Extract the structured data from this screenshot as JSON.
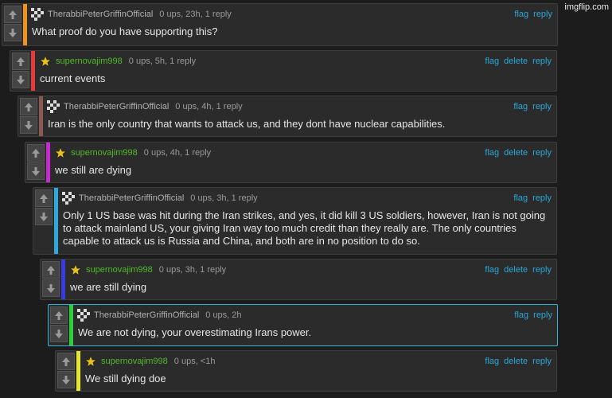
{
  "watermark": "imgflip.com",
  "colors": {
    "link": "#2aa7d8",
    "green_user": "#4fb92a",
    "grey_user": "#b0b0b0"
  },
  "comments": [
    {
      "user": "TherabbiPeterGriffinOfficial",
      "meta": "0 ups, 23h, 1 reply",
      "text": "What proof do you have supporting this?",
      "bar": "#f0931e",
      "avatar": "checker-avatar-icon",
      "actions": [
        "flag",
        "reply"
      ]
    },
    {
      "user": "supernovajim998",
      "meta": "0 ups, 5h, 1 reply",
      "text": "current events",
      "bar": "#e53a3a",
      "avatar": "star-avatar-icon",
      "actions": [
        "flag",
        "delete",
        "reply"
      ]
    },
    {
      "user": "TherabbiPeterGriffinOfficial",
      "meta": "0 ups, 4h, 1 reply",
      "text": "Iran is the only country that wants to attack us, and they dont have nuclear capabilities.",
      "bar": "#8a5a52",
      "avatar": "checker-avatar-icon",
      "actions": [
        "flag",
        "reply"
      ]
    },
    {
      "user": "supernovajim998",
      "meta": "0 ups, 4h, 1 reply",
      "text": "we still are dying",
      "bar": "#c42ad0",
      "avatar": "star-avatar-icon",
      "actions": [
        "flag",
        "delete",
        "reply"
      ]
    },
    {
      "user": "TherabbiPeterGriffinOfficial",
      "meta": "0 ups, 3h, 1 reply",
      "text": "Only 1 US base was hit during the Iran strikes, and yes, it did kill 3 US soldiers, however, Iran is not going to attack mainland US, your giving Iran way too much credit than they really are. The only countries capable to attack us is Russia and China, and both are in no position to do so.",
      "bar": "#2fa8e0",
      "avatar": "checker-avatar-icon",
      "actions": [
        "flag",
        "reply"
      ]
    },
    {
      "user": "supernovajim998",
      "meta": "0 ups, 3h, 1 reply",
      "text": "we are still dying",
      "bar": "#3a3ae0",
      "avatar": "star-avatar-icon",
      "actions": [
        "flag",
        "delete",
        "reply"
      ]
    },
    {
      "user": "TherabbiPeterGriffinOfficial",
      "meta": "0 ups, 2h",
      "text": "We are not dying, your overestimating Irans power.",
      "bar": "#2ad03a",
      "avatar": "checker-avatar-icon",
      "actions": [
        "flag",
        "reply"
      ]
    },
    {
      "user": "supernovajim998",
      "meta": "0 ups, <1h",
      "text": "We still dying doe",
      "bar": "#e6e62a",
      "avatar": "star-avatar-icon",
      "actions": [
        "flag",
        "delete",
        "reply"
      ]
    }
  ]
}
